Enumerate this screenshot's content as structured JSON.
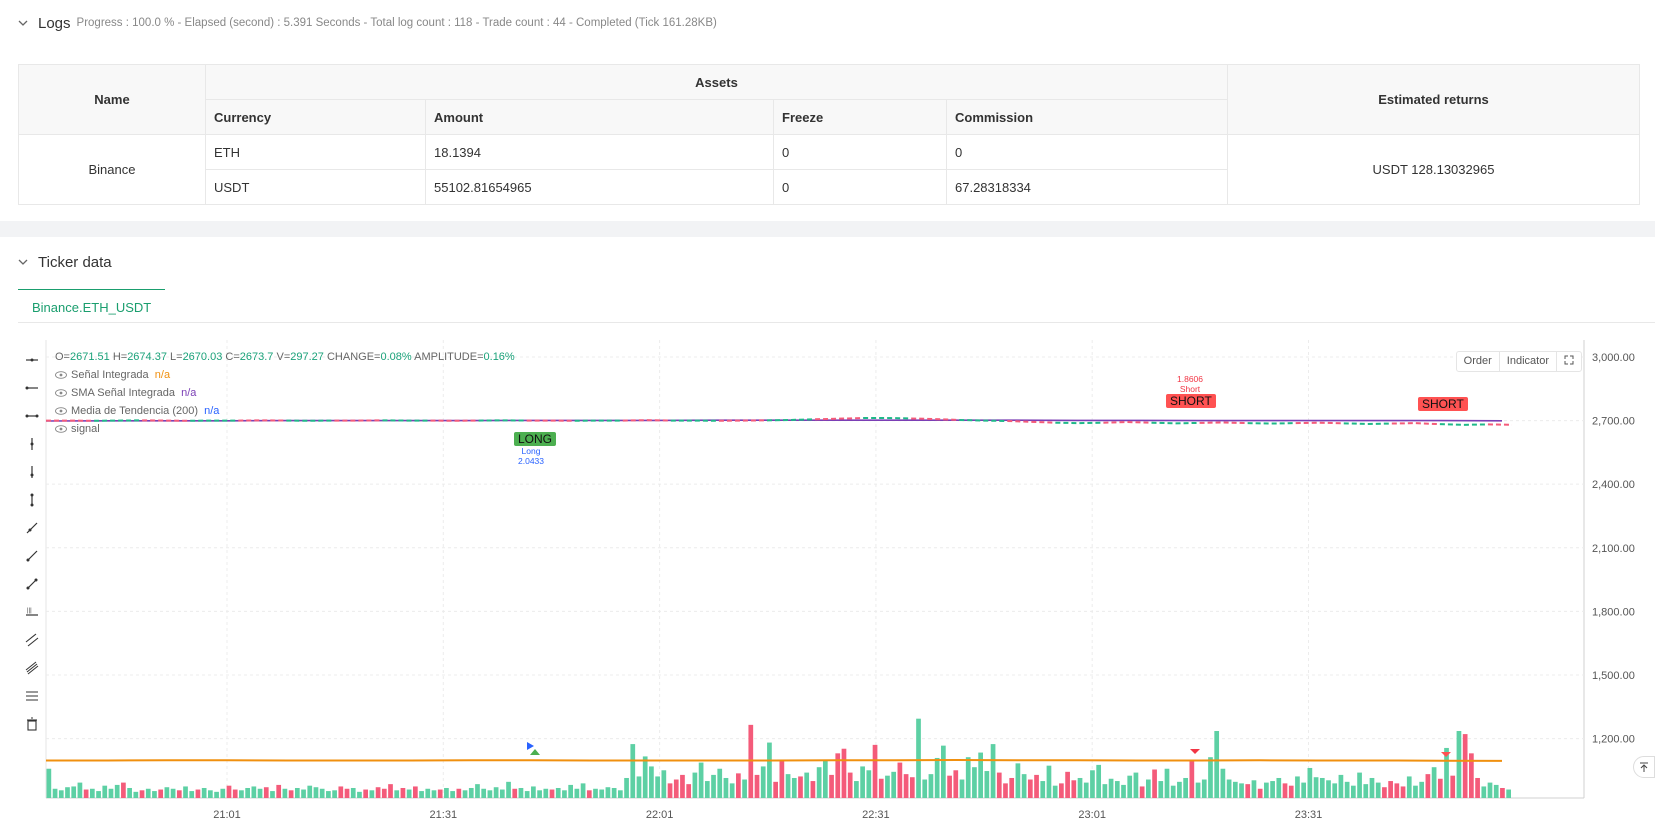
{
  "logs": {
    "title": "Logs",
    "meta": "Progress : 100.0 % - Elapsed (second) : 5.391  Seconds - Total log count : 118 - Trade count : 44 - Completed (Tick 161.28KB)"
  },
  "assets_table": {
    "col_name": "Name",
    "col_assets": "Assets",
    "col_returns": "Estimated returns",
    "col_currency": "Currency",
    "col_amount": "Amount",
    "col_freeze": "Freeze",
    "col_commission": "Commission",
    "exchange": "Binance",
    "rows": [
      {
        "currency": "ETH",
        "amount": "18.1394",
        "freeze": "0",
        "commission": "0"
      },
      {
        "currency": "USDT",
        "amount": "55102.81654965",
        "freeze": "0",
        "commission": "67.28318334"
      }
    ],
    "estimated_returns": "USDT 128.13032965"
  },
  "ticker": {
    "title": "Ticker data",
    "tab_label": "Binance.ETH_USDT"
  },
  "chart": {
    "ohlc": {
      "o_label": "O=",
      "o": "2671.51",
      "h_label": "H=",
      "h": "2674.37",
      "l_label": "L=",
      "l": "2670.03",
      "c_label": "C=",
      "c": "2673.7",
      "v_label": "V=",
      "v": "297.27",
      "change_label": "CHANGE=",
      "change": "0.08%",
      "amp_label": "AMPLITUDE=",
      "amp": "0.16%"
    },
    "legend": [
      {
        "name": "Señal Integrada",
        "value": "n/a",
        "color": "#f0900f"
      },
      {
        "name": "SMA Señal Integrada",
        "value": "n/a",
        "color": "#7b3fb5"
      },
      {
        "name": "Media de Tendencia (200)",
        "value": "n/a",
        "color": "#2962ff"
      },
      {
        "name": "signal",
        "value": "",
        "color": "#666666"
      }
    ],
    "buttons": {
      "order": "Order",
      "indicator": "Indicator"
    },
    "annotations": {
      "long_label": "LONG",
      "long_text": "Long",
      "long_value": "2.0433",
      "short_label_1": "SHORT",
      "short_text_1": "Short",
      "short_value_1": "1.8606",
      "short_label_2": "SHORT"
    }
  },
  "chart_data": {
    "type": "line",
    "x_ticks": [
      "21:01",
      "21:31",
      "22:01",
      "22:31",
      "23:01",
      "23:31"
    ],
    "y_ticks": [
      "3,000.00",
      "2,700.00",
      "2,400.00",
      "2,100.00",
      "1,800.00",
      "1,500.00",
      "1,200.00"
    ],
    "ylim": [
      920,
      3080
    ],
    "grid": true,
    "colors": {
      "up": "#5dd0a4",
      "down": "#f45b7a",
      "trend": "#7b3fb5",
      "signal": "#f0900f"
    },
    "price_series": [
      2700,
      2700,
      2699,
      2700,
      2701,
      2700,
      2699,
      2700,
      2700,
      2701,
      2700,
      2699,
      2700,
      2700,
      2701,
      2700,
      2700,
      2699,
      2700,
      2701,
      2700,
      2700,
      2699,
      2700,
      2700,
      2702,
      2700,
      2700,
      2699,
      2700,
      2701,
      2703,
      2706,
      2709,
      2712,
      2712,
      2710,
      2707,
      2703,
      2700,
      2698,
      2694,
      2690,
      2688,
      2690,
      2693,
      2690,
      2687,
      2689,
      2691,
      2688,
      2686,
      2688,
      2690,
      2687,
      2684,
      2686,
      2688,
      2683,
      2680,
      2682,
      2680
    ],
    "trend_series": [
      2698,
      2699,
      2699,
      2699,
      2700,
      2700,
      2700,
      2700,
      2701,
      2701,
      2701,
      2702,
      2702,
      2702,
      2702,
      2702,
      2702,
      2701,
      2701,
      2700,
      2700,
      2700,
      2700,
      2700,
      2699
    ],
    "signal_series": [
      1097,
      1097,
      1098,
      1098,
      1097,
      1097,
      1097,
      1098,
      1098,
      1097,
      1097,
      1097,
      1097,
      1098,
      1098,
      1099,
      1098,
      1098,
      1097,
      1097,
      1098,
      1097,
      1097,
      1096,
      1095
    ],
    "volume_heights": [
      3.8,
      1.2,
      1.0,
      1.4,
      1.5,
      2.0,
      1.1,
      1.2,
      0.9,
      1.6,
      1.2,
      1.7,
      2.0,
      1.3,
      0.8,
      1.0,
      1.2,
      0.9,
      1.1,
      1.4,
      1.2,
      1.0,
      1.5,
      0.9,
      1.1,
      1.3,
      1.0,
      0.8,
      1.2,
      1.6,
      1.1,
      1.0,
      1.3,
      1.5,
      1.2,
      1.4,
      0.9,
      1.7,
      1.2,
      1.0,
      1.3,
      1.1,
      1.6,
      1.4,
      1.2,
      0.9,
      1.0,
      1.5,
      1.2,
      1.3,
      0.8,
      1.1,
      1.0,
      1.4,
      1.2,
      1.8,
      1.0,
      1.3,
      1.1,
      1.5,
      0.9,
      1.2,
      1.0,
      1.1,
      1.3,
      0.9,
      1.2,
      1.0,
      1.3,
      1.8,
      1.2,
      1.0,
      1.4,
      1.1,
      2.1,
      1.2,
      1.3,
      0.9,
      1.5,
      1.0,
      1.2,
      1.1,
      1.3,
      1.0,
      1.7,
      1.2,
      1.9,
      1.0,
      1.2,
      1.1,
      1.4,
      1.3,
      1.0,
      2.6,
      7.0,
      2.8,
      5.4,
      4.1,
      2.8,
      3.6,
      1.9,
      2.4,
      3.0,
      1.8,
      3.3,
      4.6,
      2.2,
      3.0,
      3.8,
      2.6,
      1.9,
      3.2,
      2.4,
      9.5,
      3.0,
      4.1,
      7.2,
      2.1,
      4.8,
      3.1,
      2.6,
      2.8,
      3.3,
      2.2,
      4.0,
      5.0,
      3.0,
      5.8,
      6.4,
      3.3,
      2.2,
      4.1,
      3.6,
      6.9,
      2.5,
      2.9,
      3.4,
      4.6,
      3.1,
      2.7,
      10.3,
      2.4,
      3.1,
      5.2,
      6.8,
      2.9,
      3.6,
      2.4,
      5.3,
      4.0,
      5.9,
      3.5,
      7.0,
      3.3,
      1.9,
      2.6,
      4.5,
      3.1,
      2.4,
      3.0,
      2.2,
      4.2,
      1.6,
      1.9,
      3.4,
      2.3,
      2.6,
      2.0,
      3.6,
      4.3,
      1.8,
      2.5,
      2.2,
      1.7,
      2.9,
      3.3,
      1.5,
      2.4,
      3.7,
      2.2,
      3.8,
      1.6,
      2.1,
      2.6,
      4.9,
      2.0,
      2.4,
      5.3,
      8.7,
      3.8,
      2.4,
      2.1,
      1.9,
      1.8,
      2.3,
      1.2,
      2.0,
      2.2,
      2.6,
      1.9,
      1.6,
      2.8,
      2.0,
      3.9,
      2.7,
      2.6,
      2.3,
      1.9,
      3.0,
      2.1,
      1.6,
      3.3,
      1.8,
      2.6,
      2.0,
      1.4,
      2.2,
      1.9,
      1.5,
      2.8,
      1.6,
      2.1,
      3.1,
      4.0,
      2.5,
      6.5,
      2.9,
      8.7,
      8.3,
      5.8,
      2.6,
      1.5,
      2.0,
      1.7,
      1.3,
      1.1
    ],
    "volume_colors": "alternating"
  }
}
